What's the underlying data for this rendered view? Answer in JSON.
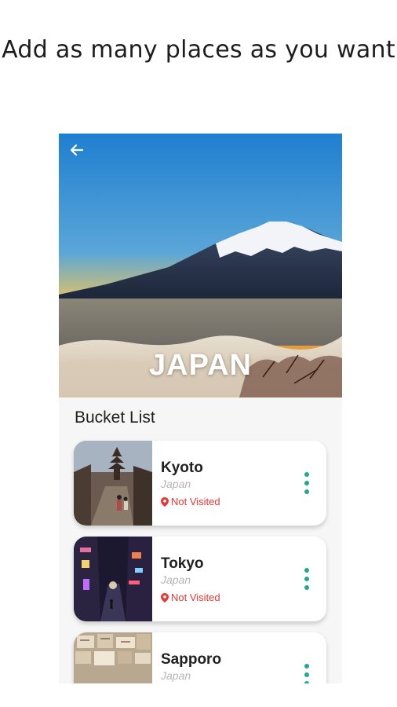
{
  "promo": {
    "title": "Add as many places as you want"
  },
  "hero": {
    "country_title": "JAPAN",
    "back_icon": "arrow-left-icon"
  },
  "bucket_list": {
    "heading": "Bucket List",
    "items": [
      {
        "name": "Kyoto",
        "country": "Japan",
        "status": "Not Visited",
        "status_icon": "location-pin-icon",
        "menu_icon": "more-vert-icon"
      },
      {
        "name": "Tokyo",
        "country": "Japan",
        "status": "Not Visited",
        "status_icon": "location-pin-icon",
        "menu_icon": "more-vert-icon"
      },
      {
        "name": "Sapporo",
        "country": "Japan",
        "status": "",
        "status_icon": "location-pin-icon",
        "menu_icon": "more-vert-icon"
      }
    ]
  },
  "colors": {
    "accent": "#21a88f",
    "status_not_visited": "#e53935",
    "background": "#f6f6f6"
  }
}
